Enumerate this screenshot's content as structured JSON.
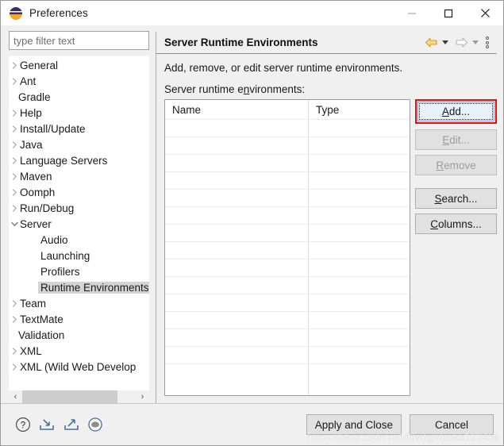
{
  "window": {
    "title": "Preferences",
    "icon": "eclipse-icon",
    "controls": {
      "minimize": "minimize-icon",
      "maximize": "maximize-icon",
      "close": "close-icon"
    }
  },
  "sidebar": {
    "filter": {
      "value": "",
      "placeholder": "type filter text"
    },
    "items": [
      {
        "label": "General",
        "depth": 0,
        "expandable": true,
        "expanded": false,
        "selected": false
      },
      {
        "label": "Ant",
        "depth": 0,
        "expandable": true,
        "expanded": false,
        "selected": false
      },
      {
        "label": "Gradle",
        "depth": 0,
        "expandable": false,
        "expanded": false,
        "selected": false
      },
      {
        "label": "Help",
        "depth": 0,
        "expandable": true,
        "expanded": false,
        "selected": false
      },
      {
        "label": "Install/Update",
        "depth": 0,
        "expandable": true,
        "expanded": false,
        "selected": false
      },
      {
        "label": "Java",
        "depth": 0,
        "expandable": true,
        "expanded": false,
        "selected": false
      },
      {
        "label": "Language Servers",
        "depth": 0,
        "expandable": true,
        "expanded": false,
        "selected": false
      },
      {
        "label": "Maven",
        "depth": 0,
        "expandable": true,
        "expanded": false,
        "selected": false
      },
      {
        "label": "Oomph",
        "depth": 0,
        "expandable": true,
        "expanded": false,
        "selected": false
      },
      {
        "label": "Run/Debug",
        "depth": 0,
        "expandable": true,
        "expanded": false,
        "selected": false
      },
      {
        "label": "Server",
        "depth": 0,
        "expandable": true,
        "expanded": true,
        "selected": false
      },
      {
        "label": "Audio",
        "depth": 1,
        "expandable": false,
        "expanded": false,
        "selected": false
      },
      {
        "label": "Launching",
        "depth": 1,
        "expandable": false,
        "expanded": false,
        "selected": false
      },
      {
        "label": "Profilers",
        "depth": 1,
        "expandable": false,
        "expanded": false,
        "selected": false
      },
      {
        "label": "Runtime Environments",
        "depth": 1,
        "expandable": false,
        "expanded": false,
        "selected": true
      },
      {
        "label": "Team",
        "depth": 0,
        "expandable": true,
        "expanded": false,
        "selected": false
      },
      {
        "label": "TextMate",
        "depth": 0,
        "expandable": true,
        "expanded": false,
        "selected": false
      },
      {
        "label": "Validation",
        "depth": 0,
        "expandable": false,
        "expanded": false,
        "selected": false
      },
      {
        "label": "XML",
        "depth": 0,
        "expandable": true,
        "expanded": false,
        "selected": false
      },
      {
        "label": "XML (Wild Web Develop",
        "depth": 0,
        "expandable": true,
        "expanded": false,
        "selected": false
      }
    ],
    "scrollbar": {
      "left_arrow": "‹",
      "right_arrow": "›"
    }
  },
  "page": {
    "title": "Server Runtime Environments",
    "description": "Add, remove, or edit server runtime environments.",
    "table_label_before": "Server runtime e",
    "table_label_mnemonic": "n",
    "table_label_after": "vironments:",
    "header_tools": {
      "back": "back-arrow-icon",
      "back_menu": "back-dropdown-icon",
      "forward": "forward-arrow-icon",
      "forward_menu": "forward-dropdown-icon",
      "view_menu": "view-menu-icon"
    },
    "table": {
      "columns": [
        "Name",
        "Type"
      ],
      "rows": [],
      "empty_row_count": 15
    },
    "buttons": [
      {
        "label_before": "",
        "mnemonic": "A",
        "label_after": "dd...",
        "name": "add-button",
        "state": "focused-highlighted"
      },
      {
        "label_before": "",
        "mnemonic": "E",
        "label_after": "dit...",
        "name": "edit-button",
        "state": "disabled"
      },
      {
        "label_before": "",
        "mnemonic": "R",
        "label_after": "emove",
        "name": "remove-button",
        "state": "disabled"
      },
      {
        "label_before": "",
        "mnemonic": "S",
        "label_after": "earch...",
        "name": "search-button",
        "state": "enabled"
      },
      {
        "label_before": "",
        "mnemonic": "C",
        "label_after": "olumns...",
        "name": "columns-button",
        "state": "enabled"
      }
    ]
  },
  "footer": {
    "icons": [
      "help-icon",
      "import-icon",
      "export-icon",
      "restore-defaults-icon"
    ],
    "apply_and_close": "Apply and Close",
    "cancel": "Cancel",
    "watermark": "https://blog.csdn.net/fffvdgjvbsikb123456"
  },
  "colors": {
    "accent_red": "#fb0404",
    "focus_blue": "#e8f2fb",
    "selection_gray": "#d4d4d4",
    "back_arrow_orange": "#e8a33d"
  }
}
